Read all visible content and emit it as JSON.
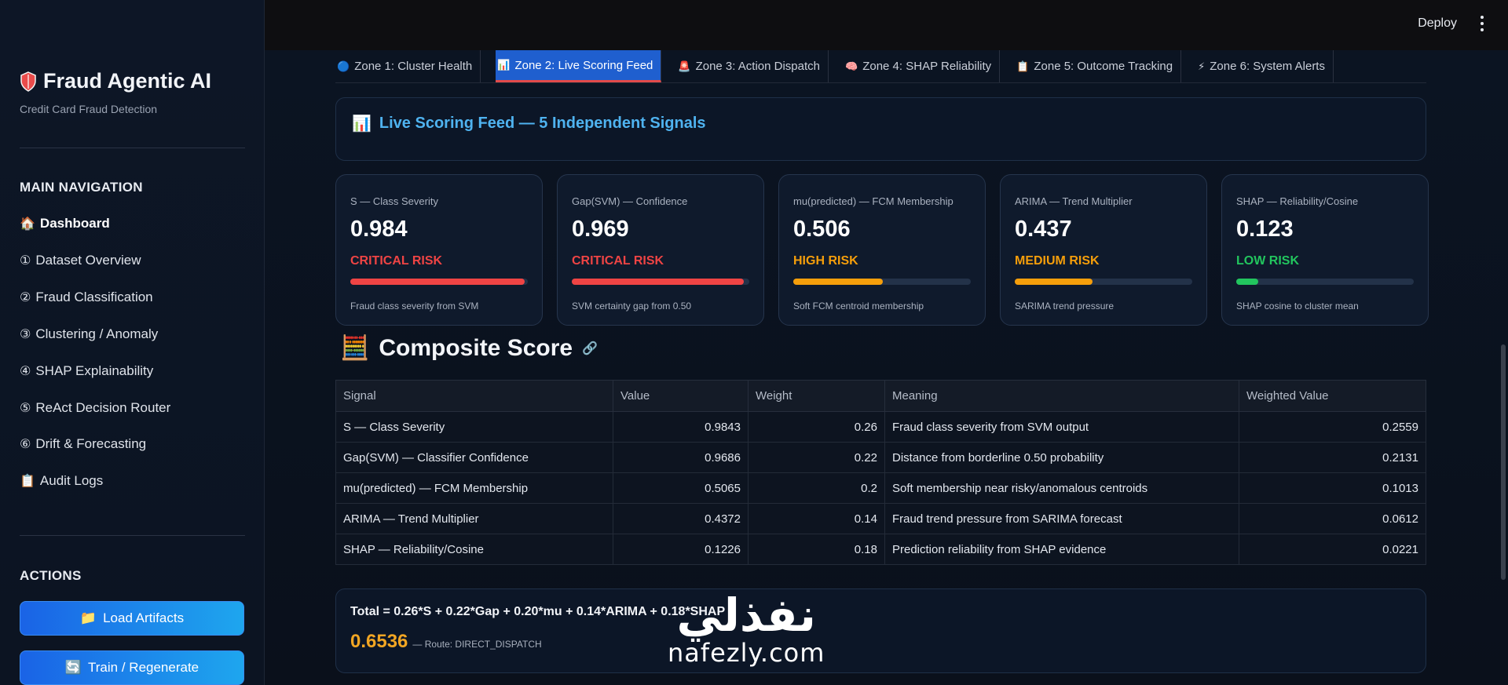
{
  "sidebar": {
    "title": "Fraud Agentic AI",
    "subtitle": "Credit Card Fraud Detection",
    "nav_heading": "MAIN NAVIGATION",
    "nav_items": [
      {
        "glyph": "🏠",
        "label": "Dashboard"
      },
      {
        "glyph": "①",
        "label": "Dataset Overview"
      },
      {
        "glyph": "②",
        "label": "Fraud Classification"
      },
      {
        "glyph": "③",
        "label": "Clustering / Anomaly"
      },
      {
        "glyph": "④",
        "label": "SHAP Explainability"
      },
      {
        "glyph": "⑤",
        "label": "ReAct Decision Router"
      },
      {
        "glyph": "⑥",
        "label": "Drift & Forecasting"
      },
      {
        "glyph": "📋",
        "label": "Audit Logs"
      }
    ],
    "actions_heading": "ACTIONS",
    "actions": [
      {
        "glyph": "📁",
        "label": "Load Artifacts"
      },
      {
        "glyph": "🔄",
        "label": "Train / Regenerate"
      }
    ]
  },
  "topbar": {
    "deploy_label": "Deploy"
  },
  "tabs": [
    {
      "icon": "🔵",
      "label": "Zone 1: Cluster Health"
    },
    {
      "icon": "📊",
      "label": "Zone 2: Live Scoring Feed"
    },
    {
      "icon": "🚨",
      "label": "Zone 3: Action Dispatch"
    },
    {
      "icon": "🧠",
      "label": "Zone 4: SHAP Reliability"
    },
    {
      "icon": "📋",
      "label": "Zone 5: Outcome Tracking"
    },
    {
      "icon": "⚡",
      "label": "Zone 6: System Alerts"
    }
  ],
  "feed": {
    "icon": "📊",
    "title": "Live Scoring Feed — 5 Independent Signals"
  },
  "signals": [
    {
      "label": "S — Class Severity",
      "value": "0.984",
      "risk": "CRITICAL RISK",
      "level": 0.984,
      "risk_color": "#ef4444",
      "desc": "Fraud class severity from SVM"
    },
    {
      "label": "Gap(SVM) — Confidence",
      "value": "0.969",
      "risk": "CRITICAL RISK",
      "level": 0.969,
      "risk_color": "#ef4444",
      "desc": "SVM certainty gap from 0.50"
    },
    {
      "label": "mu(predicted) — FCM Membership",
      "value": "0.506",
      "risk": "HIGH RISK",
      "level": 0.506,
      "risk_color": "#f59e0b",
      "desc": "Soft FCM centroid membership"
    },
    {
      "label": "ARIMA — Trend Multiplier",
      "value": "0.437",
      "risk": "MEDIUM RISK",
      "level": 0.437,
      "risk_color": "#f59e0b",
      "desc": "SARIMA trend pressure"
    },
    {
      "label": "SHAP — Reliability/Cosine",
      "value": "0.123",
      "risk": "LOW RISK",
      "level": 0.123,
      "risk_color": "#22c55e",
      "desc": "SHAP cosine to cluster mean"
    }
  ],
  "composite": {
    "icon": "🧮",
    "title": "Composite Score",
    "headers": [
      "Signal",
      "Value",
      "Weight",
      "Meaning",
      "Weighted Value"
    ],
    "rows": [
      [
        "S — Class Severity",
        "0.9843",
        "0.26",
        "Fraud class severity from SVM output",
        "0.2559"
      ],
      [
        "Gap(SVM) — Classifier Confidence",
        "0.9686",
        "0.22",
        "Distance from borderline 0.50 probability",
        "0.2131"
      ],
      [
        "mu(predicted) — FCM Membership",
        "0.5065",
        "0.2",
        "Soft membership near risky/anomalous centroids",
        "0.1013"
      ],
      [
        "ARIMA — Trend Multiplier",
        "0.4372",
        "0.14",
        "Fraud trend pressure from SARIMA forecast",
        "0.0612"
      ],
      [
        "SHAP — Reliability/Cosine",
        "0.1226",
        "0.18",
        "Prediction reliability from SHAP evidence",
        "0.0221"
      ]
    ],
    "formula": "Total = 0.26*S + 0.22*Gap + 0.20*mu + 0.14*ARIMA + 0.18*SHAP",
    "total": "0.6536",
    "route": "— Route: DIRECT_DISPATCH"
  },
  "watermark": {
    "arabic": "نفذلي",
    "latin": "nafezly.com"
  }
}
